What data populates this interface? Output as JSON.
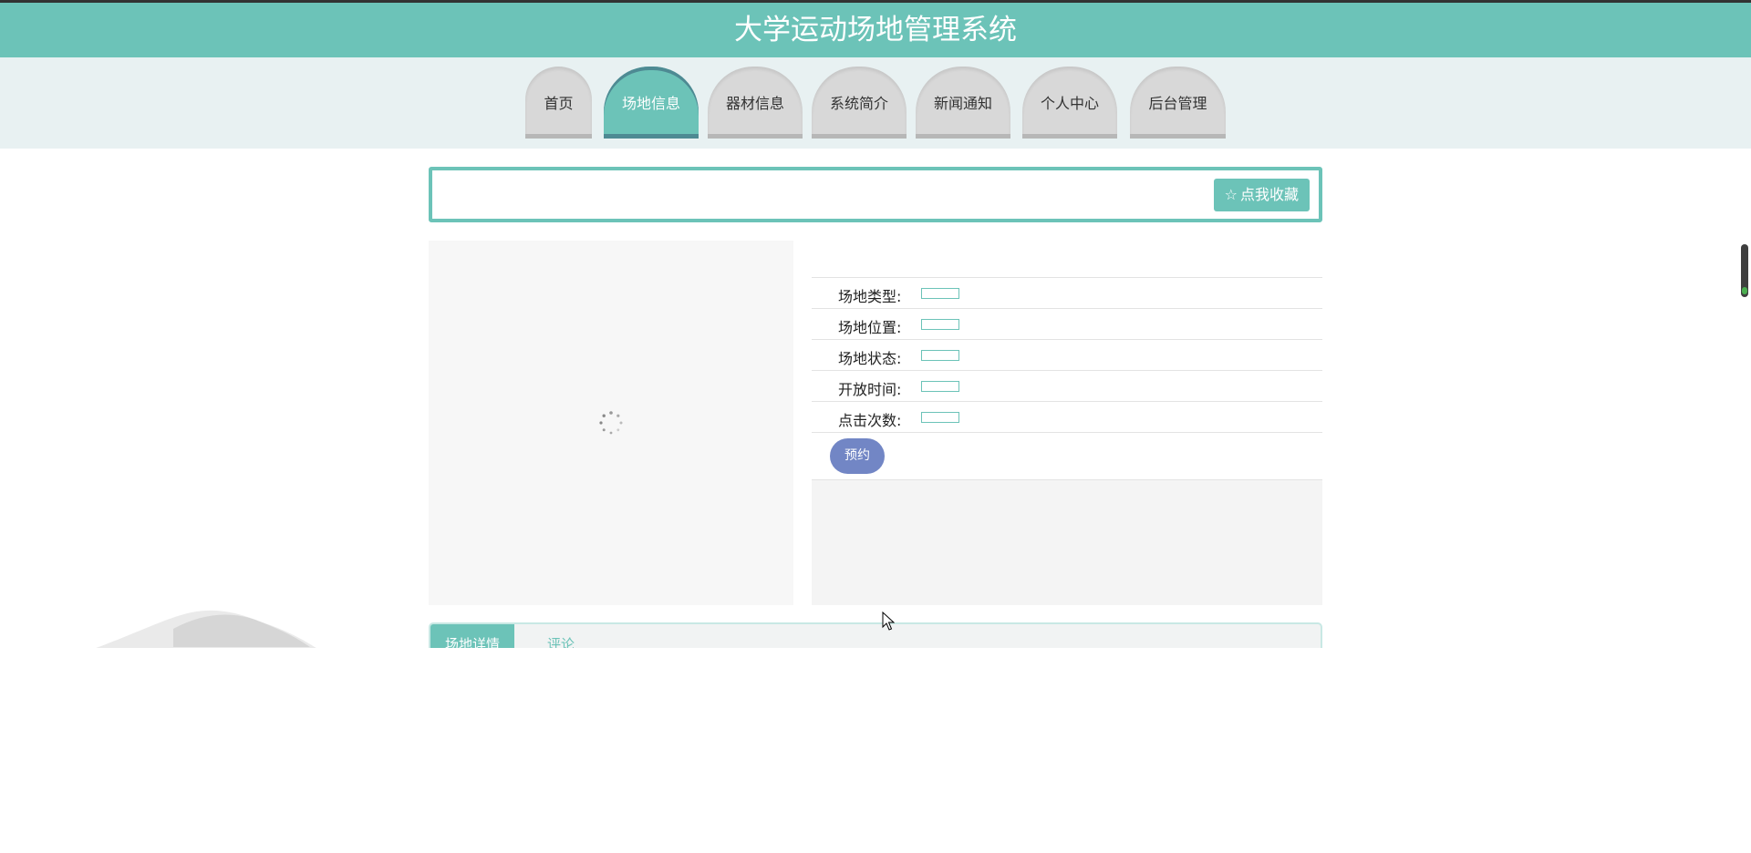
{
  "header": {
    "title": "大学运动场地管理系统"
  },
  "nav": {
    "items": [
      {
        "label": "首页",
        "active": false
      },
      {
        "label": "场地信息",
        "active": true
      },
      {
        "label": "器材信息",
        "active": false
      },
      {
        "label": "系统简介",
        "active": false
      },
      {
        "label": "新闻通知",
        "active": false
      },
      {
        "label": "个人中心",
        "active": false
      },
      {
        "label": "后台管理",
        "active": false
      }
    ]
  },
  "favorite": {
    "icon": "star-icon",
    "label": "点我收藏"
  },
  "venue_info": {
    "fields": [
      {
        "label": "场地类型:",
        "value": ""
      },
      {
        "label": "场地位置:",
        "value": ""
      },
      {
        "label": "场地状态:",
        "value": ""
      },
      {
        "label": "开放时间:",
        "value": ""
      },
      {
        "label": "点击次数:",
        "value": ""
      }
    ],
    "reserve_label": "预约"
  },
  "tabs": {
    "detail_label": "场地详情",
    "comment_label": "评论"
  },
  "colors": {
    "accent": "#6cc3b8",
    "button_blue": "#7286c5",
    "nav_tab": "#d8d8d8"
  }
}
